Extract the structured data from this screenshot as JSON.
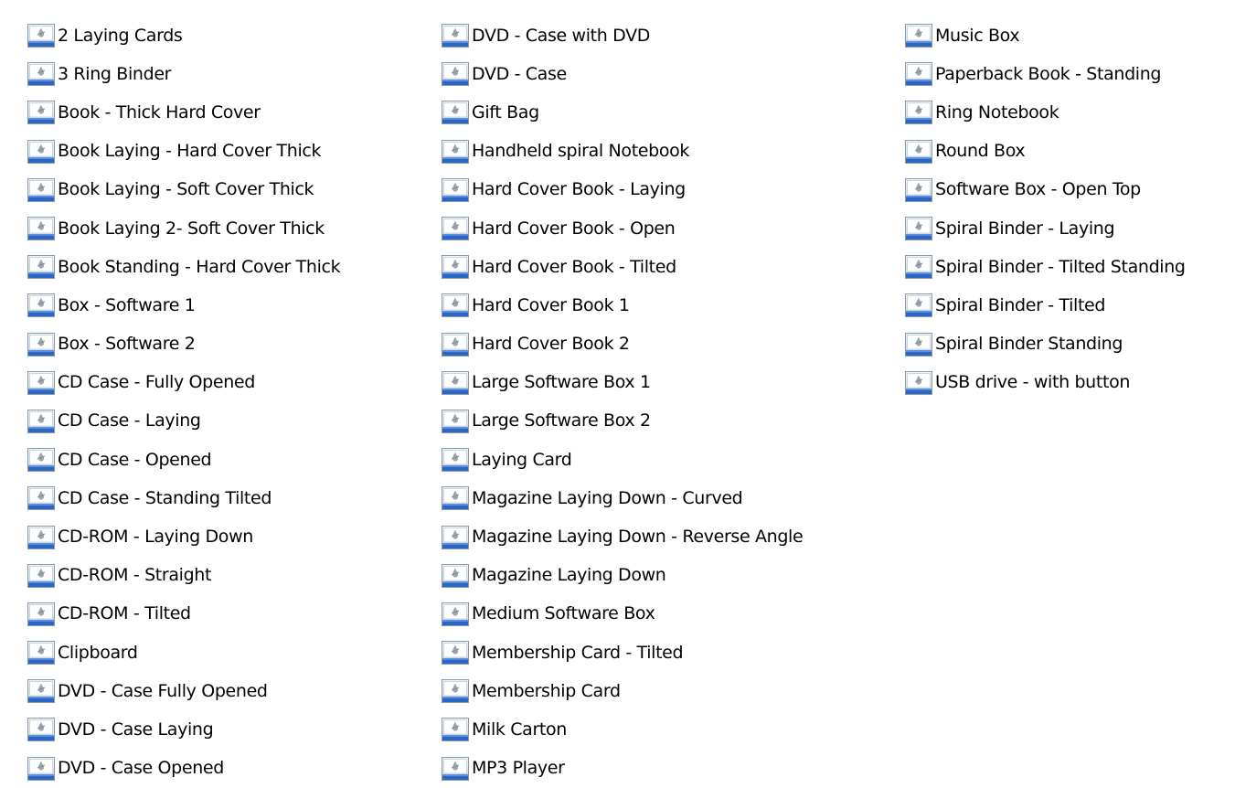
{
  "icon": "image-file-icon",
  "columns": [
    {
      "items": [
        "2 Laying Cards",
        "3 Ring Binder",
        "Book - Thick Hard Cover",
        "Book Laying - Hard Cover Thick",
        "Book Laying - Soft Cover Thick",
        "Book Laying 2- Soft Cover Thick",
        "Book Standing - Hard Cover Thick",
        "Box - Software 1",
        "Box - Software 2",
        "CD Case - Fully Opened",
        "CD Case - Laying",
        "CD Case - Opened",
        "CD Case - Standing Tilted",
        "CD-ROM - Laying Down",
        "CD-ROM - Straight",
        "CD-ROM - Tilted",
        "Clipboard",
        "DVD - Case Fully Opened",
        "DVD - Case Laying",
        "DVD - Case Opened"
      ]
    },
    {
      "items": [
        "DVD - Case with DVD",
        "DVD - Case",
        "Gift Bag",
        "Handheld spiral Notebook",
        "Hard Cover Book - Laying",
        "Hard Cover Book - Open",
        "Hard Cover Book - Tilted",
        "Hard Cover Book 1",
        "Hard Cover Book 2",
        "Large Software Box 1",
        "Large Software Box 2",
        "Laying Card",
        "Magazine Laying Down - Curved",
        "Magazine Laying Down - Reverse Angle",
        "Magazine Laying Down",
        "Medium Software Box",
        "Membership Card - Tilted",
        "Membership Card",
        "Milk Carton",
        "MP3 Player"
      ]
    },
    {
      "items": [
        "Music Box",
        "Paperback Book - Standing",
        "Ring Notebook",
        "Round Box",
        "Software Box - Open Top",
        "Spiral Binder - Laying",
        "Spiral Binder - Tilted Standing",
        "Spiral Binder - Tilted",
        "Spiral Binder Standing",
        "USB drive - with button"
      ]
    }
  ]
}
